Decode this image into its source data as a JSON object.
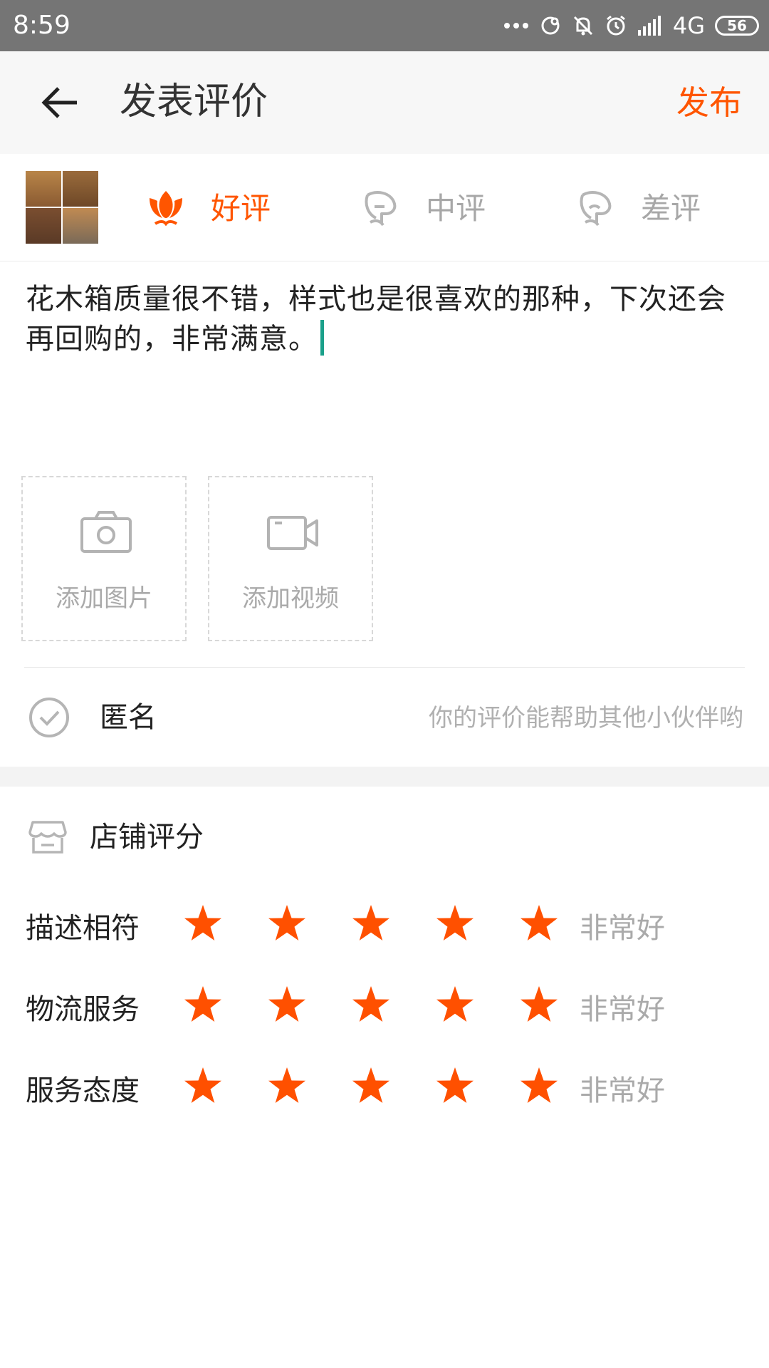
{
  "status_bar": {
    "time": "8:59",
    "network": "4G",
    "battery": "56"
  },
  "app_bar": {
    "title": "发表评价",
    "publish_label": "发布"
  },
  "rating_tabs": [
    {
      "label": "好评",
      "icon": "flower-icon",
      "selected": true
    },
    {
      "label": "中评",
      "icon": "neutral-face-icon",
      "selected": false
    },
    {
      "label": "差评",
      "icon": "sad-face-icon",
      "selected": false
    }
  ],
  "comment": {
    "text": "花木箱质量很不错，样式也是很喜欢的那种，下次还会再回购的，非常满意。"
  },
  "media": {
    "add_photo_label": "添加图片",
    "add_video_label": "添加视频"
  },
  "anonymous": {
    "label": "匿名",
    "hint": "你的评价能帮助其他小伙伴哟"
  },
  "store_rating": {
    "title": "店铺评分",
    "rows": [
      {
        "label": "描述相符",
        "stars": 5,
        "value_text": "非常好"
      },
      {
        "label": "物流服务",
        "stars": 5,
        "value_text": "非常好"
      },
      {
        "label": "服务态度",
        "stars": 5,
        "value_text": "非常好"
      }
    ]
  },
  "colors": {
    "accent": "#ff5500",
    "star": "#ff5000",
    "cursor": "#1aa08a",
    "status_bar": "#757575"
  }
}
